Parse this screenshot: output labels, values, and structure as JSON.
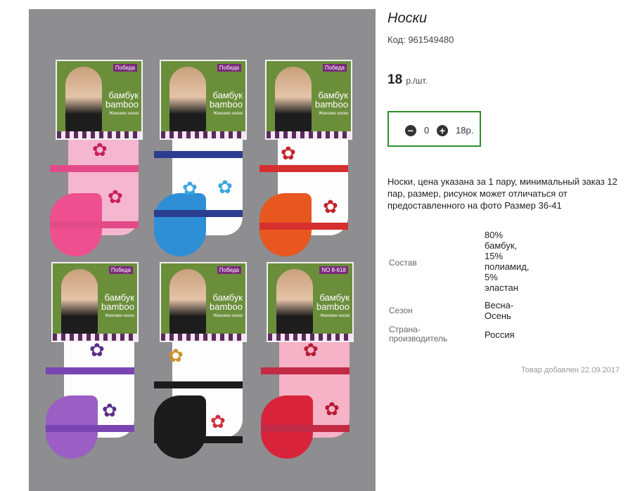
{
  "product": {
    "title": "Носки",
    "code": "Код: 961549480",
    "price": "18",
    "price_unit": "р./шт.",
    "qty": "0",
    "total": "18р.",
    "description": "Носки, цена указана за 1 пару, минимальный заказ 12 пар, размер, рисунок может отличаться от предоставленного на фото Размер 36-41",
    "added": "Товар добавлен 22.09.2017"
  },
  "specs": [
    {
      "label": "Состав",
      "value": "80% бамбук, 15% полиамид, 5% эластан"
    },
    {
      "label": "Сезон",
      "value": "Весна-Осень"
    },
    {
      "label": "Страна-производитель",
      "value": "Россия"
    }
  ],
  "packaging": {
    "logo": "Победа",
    "brand_ru": "бамбук",
    "brand_en": "bamboo",
    "sub": "Женские носки",
    "code": "NO 8-618"
  },
  "colors": {
    "accent_border": "#2f8f2a",
    "photo_bg": "#8e8d90",
    "socks": [
      "#ee4f8f",
      "#2f8fd6",
      "#e8571f",
      "#9a5ec4",
      "#1b1b1b",
      "#d8233a"
    ]
  },
  "icons": {
    "minus": "minus-circle-icon",
    "plus": "plus-circle-icon"
  }
}
